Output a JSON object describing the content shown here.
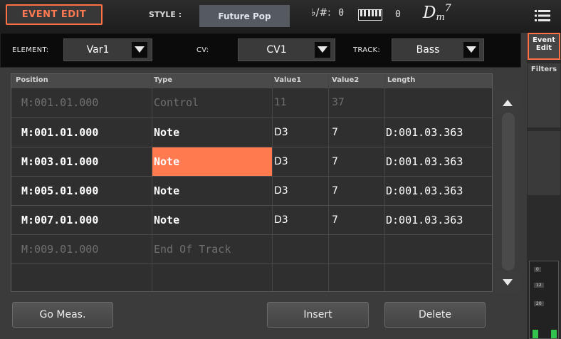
{
  "header": {
    "page_label": "EVENT EDIT",
    "style_label": "STYLE :",
    "style_value": "Future Pop",
    "key_sig_label": "♭/#:",
    "key_sig_value": "0",
    "transpose_value": "0",
    "chord_root": "D",
    "chord_quality": "m",
    "chord_ext": "7"
  },
  "selectors": {
    "element_label": "ELEMENT:",
    "element_value": "Var1",
    "cv_label": "CV:",
    "cv_value": "CV1",
    "track_label": "TRACK:",
    "track_value": "Bass"
  },
  "tabs": {
    "event_edit": "Event Edit",
    "filters": "Filters"
  },
  "table": {
    "columns": [
      "Position",
      "Type",
      "Value1",
      "Value2",
      "Length"
    ],
    "rows": [
      {
        "position": "M:001.01.000",
        "type": "Control",
        "value1": "11",
        "value2": "37",
        "length": "",
        "dim": true
      },
      {
        "position": "M:001.01.000",
        "type": "Note",
        "value1": "D3",
        "value2": "7",
        "length": "D:001.03.363",
        "dim": false
      },
      {
        "position": "M:003.01.000",
        "type": "Note",
        "value1": "D3",
        "value2": "7",
        "length": "D:001.03.363",
        "dim": false,
        "selected": true
      },
      {
        "position": "M:005.01.000",
        "type": "Note",
        "value1": "D3",
        "value2": "7",
        "length": "D:001.03.363",
        "dim": false
      },
      {
        "position": "M:007.01.000",
        "type": "Note",
        "value1": "D3",
        "value2": "7",
        "length": "D:001.03.363",
        "dim": false
      },
      {
        "position": "M:009.01.000",
        "type": "End Of Track",
        "value1": "",
        "value2": "",
        "length": "",
        "dim": true
      }
    ]
  },
  "meter": {
    "ticks": [
      "0",
      "12",
      "20"
    ]
  },
  "buttons": {
    "go_meas": "Go Meas.",
    "insert": "Insert",
    "delete": "Delete"
  },
  "colors": {
    "accent": "#ff7043",
    "selected_cell": "#ff7a4f",
    "background": "#3b3b3b"
  },
  "icons": {
    "menu": "hamburger-menu-icon",
    "keyboard": "keyboard-icon",
    "dropdown": "triangle-down-icon",
    "scroll_up": "triangle-up-icon",
    "scroll_down": "triangle-down-icon"
  }
}
